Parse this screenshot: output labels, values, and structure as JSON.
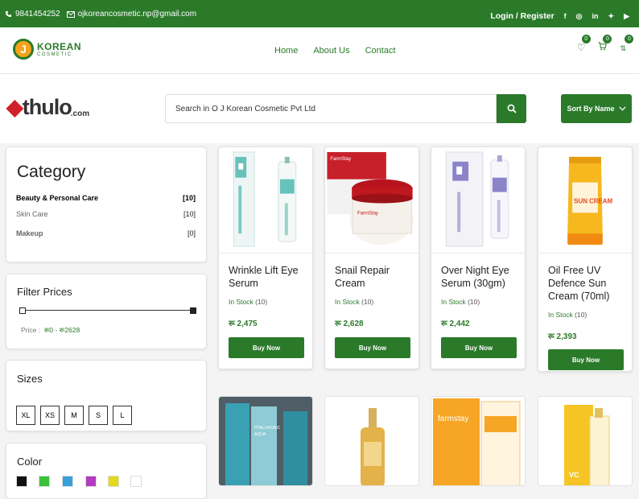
{
  "topbar": {
    "phone": "9841454252",
    "email": "ojkoreancosmetic.np@gmail.com",
    "login": "Login / Register",
    "social_icons": [
      "facebook-icon",
      "instagram-icon",
      "linkedin-icon",
      "twitter-icon",
      "youtube-icon"
    ]
  },
  "navbar": {
    "logo_main": "KOREAN",
    "logo_sub": "COSMETIC",
    "logo_letter": "J",
    "menu": [
      "Home",
      "About Us",
      "Contact"
    ],
    "wishlist_count": "0",
    "cart_count": "0",
    "compare_count": "0"
  },
  "branding": {
    "thulo_a": "thulo",
    "thulo_b": ".com"
  },
  "search": {
    "value": "Search in O J Korean Cosmetic Pvt Ltd",
    "sort_label": "Sort By Name"
  },
  "sidebar": {
    "category_title": "Category",
    "categories": [
      {
        "name": "Beauty & Personal Care",
        "count": "[10]"
      },
      {
        "name": "Skin Care",
        "count": "[10]"
      },
      {
        "name": "Makeup",
        "count": "[0]"
      }
    ],
    "filter_title": "Filter Prices",
    "price_label": "Price :",
    "price_range": "रू0 - रू2628",
    "sizes_title": "Sizes",
    "sizes": [
      "XL",
      "XS",
      "M",
      "S",
      "L"
    ],
    "color_title": "Color",
    "colors": [
      "#111111",
      "#39c23a",
      "#3aa0d8",
      "#b23cc0",
      "#e6d81a",
      "#ffffff"
    ]
  },
  "products": [
    {
      "name": "Wrinkle Lift Eye Serum",
      "stock": "In Stock",
      "qty": "(10)",
      "price": "रू 2,475",
      "buy": "Buy Now"
    },
    {
      "name": "Snail Repair Cream",
      "stock": "In Stock",
      "qty": "(10)",
      "price": "रू 2,628",
      "buy": "Buy Now"
    },
    {
      "name": "Over Night Eye Serum (30gm)",
      "stock": "In Stock",
      "qty": "(10)",
      "price": "रू 2,442",
      "buy": "Buy Now"
    },
    {
      "name": "Oil Free UV Defence Sun Cream (70ml)",
      "stock": "In Stock",
      "qty": "(10)",
      "price": "रू 2,393",
      "buy": "Buy Now"
    }
  ],
  "product_images": {
    "p2_label": "FarmStay",
    "p4_label": "SUN CREAM",
    "r2_a_label": "HYALURONIC",
    "r2_b_label": "AQUA",
    "r2_c_label": "farmstay",
    "r2_d_label": "VC"
  }
}
